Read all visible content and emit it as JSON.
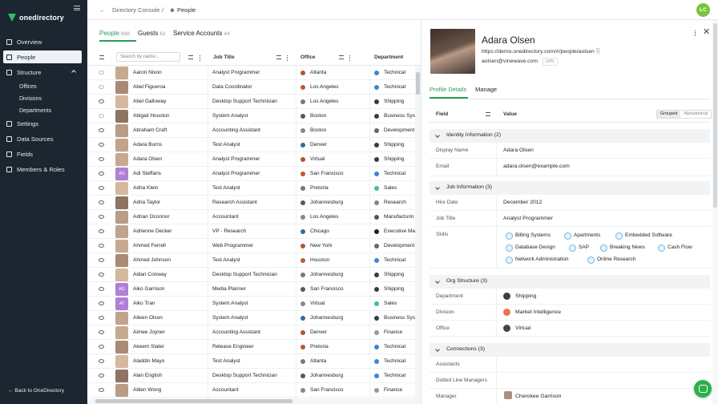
{
  "brand": {
    "name": "onedirectory"
  },
  "user_initials": "LC",
  "breadcrumb": {
    "parent": "Directory Console",
    "current": "People"
  },
  "sidebar": {
    "items": [
      {
        "label": "Overview",
        "icon": "grid-icon"
      },
      {
        "label": "People",
        "icon": "person-icon",
        "active": true
      },
      {
        "label": "Structure",
        "icon": "structure-icon"
      },
      {
        "label": "Settings",
        "icon": "gear-icon"
      },
      {
        "label": "Data Sources",
        "icon": "database-icon"
      },
      {
        "label": "Fields",
        "icon": "fields-icon"
      },
      {
        "label": "Members & Roles",
        "icon": "users-icon"
      }
    ],
    "sub_items": [
      "Offices",
      "Divisions",
      "Departments"
    ],
    "back_label": "Back to OneDirectory"
  },
  "tabs": [
    {
      "label": "People",
      "count": "998",
      "active": true
    },
    {
      "label": "Guests",
      "count": "62"
    },
    {
      "label": "Service Accounts",
      "count": "44"
    }
  ],
  "table": {
    "search_placeholder": "Search by name...",
    "columns": [
      "Job Title",
      "Office",
      "Department"
    ],
    "rows": [
      {
        "name": "Aaron Nixon",
        "job": "Analyst Programmer",
        "office": "Atlanta",
        "dept": "Technical",
        "eye": "dim"
      },
      {
        "name": "Abel Figueroa",
        "job": "Data Coordinator",
        "office": "Los Angeles",
        "dept": "Technical",
        "eye": "dim"
      },
      {
        "name": "Abel Galloway",
        "job": "Desktop Support Technician",
        "office": "Los Angeles",
        "dept": "Shipping"
      },
      {
        "name": "Abigail Houston",
        "job": "System Analyst",
        "office": "Boston",
        "dept": "Business Sys",
        "eye": "dim"
      },
      {
        "name": "Abraham Craft",
        "job": "Accounting Assistant",
        "office": "Boston",
        "dept": "Development"
      },
      {
        "name": "Adara Burns",
        "job": "Test Analyst",
        "office": "Denver",
        "dept": "Shipping"
      },
      {
        "name": "Adara Olsen",
        "job": "Analyst Programmer",
        "office": "Virtual",
        "dept": "Shipping"
      },
      {
        "name": "Adi Steffans",
        "job": "Analyst Programmer",
        "office": "San Francisco",
        "dept": "Technical",
        "initials": "AS"
      },
      {
        "name": "Adria Klein",
        "job": "Test Analyst",
        "office": "Pretoria",
        "dept": "Sales"
      },
      {
        "name": "Adria Taylor",
        "job": "Research Assistant",
        "office": "Johannesburg",
        "dept": "Research"
      },
      {
        "name": "Adrian Oconnor",
        "job": "Accountant",
        "office": "Los Angeles",
        "dept": "Manufacturin"
      },
      {
        "name": "Adrienne Decker",
        "job": "VP - Research",
        "office": "Chicago",
        "dept": "Executive Ma"
      },
      {
        "name": "Ahmed Ferrell",
        "job": "Web Programmer",
        "office": "New York",
        "dept": "Development"
      },
      {
        "name": "Ahmed Johnson",
        "job": "Test Analyst",
        "office": "Houston",
        "dept": "Technical"
      },
      {
        "name": "Aidan Conway",
        "job": "Desktop Support Technician",
        "office": "Johannesburg",
        "dept": "Shipping"
      },
      {
        "name": "Aiko Garrison",
        "job": "Media Planner",
        "office": "San Francisco",
        "dept": "Shipping",
        "initials": "AG"
      },
      {
        "name": "Aiko Tran",
        "job": "System Analyst",
        "office": "Virtual",
        "dept": "Sales",
        "initials": "AT"
      },
      {
        "name": "Aileen Olson",
        "job": "System Analyst",
        "office": "Johannesburg",
        "dept": "Business Sys"
      },
      {
        "name": "Aimee Joyner",
        "job": "Accounting Assistant",
        "office": "Denver",
        "dept": "Finance"
      },
      {
        "name": "Akeem Slater",
        "job": "Release Engineer",
        "office": "Pretoria",
        "dept": "Technical"
      },
      {
        "name": "Aladdin Mayo",
        "job": "Test Analyst",
        "office": "Atlanta",
        "dept": "Technical"
      },
      {
        "name": "Alan English",
        "job": "Desktop Support Technician",
        "office": "Johannesburg",
        "dept": "Technical"
      },
      {
        "name": "Alden Wong",
        "job": "Accountant",
        "office": "San Francisco",
        "dept": "Finance"
      }
    ]
  },
  "profile": {
    "name": "Adara Olsen",
    "url": "https://demo.onedirectory.com/#/people/aolsen",
    "email": "aolsen@vinewave.com",
    "email_badge": "UPN",
    "tabs": [
      "Profile Details",
      "Manage"
    ],
    "field_header": "Field",
    "value_header": "Value",
    "view_toggle": [
      "Grouped",
      "Alphabetical"
    ],
    "sections": {
      "identity": "Identity Information (2)",
      "job": "Job Information (3)",
      "org": "Org Structure (3)",
      "connections": "Connections (3)"
    },
    "fields": {
      "display_name": {
        "label": "Display Name",
        "value": "Adara Olsen"
      },
      "email": {
        "label": "Email",
        "value": "adara.olsen@example.com"
      },
      "hire_date": {
        "label": "Hire Date",
        "value": "December 2012"
      },
      "job_title": {
        "label": "Job Title",
        "value": "Analyst Programmer"
      },
      "skills_label": "Skills",
      "department": {
        "label": "Department",
        "value": "Shipping"
      },
      "division": {
        "label": "Division",
        "value": "Market Intelligence"
      },
      "office": {
        "label": "Office",
        "value": "Virtual"
      },
      "assistants": {
        "label": "Assistants"
      },
      "dotted_line": {
        "label": "Dotted Line Managers"
      },
      "manager": {
        "label": "Manager",
        "value": "Cherokee Garrison"
      }
    },
    "skills": [
      "Billing Systems",
      "Apartments",
      "Embedded Software",
      "Database Design",
      "SAP",
      "Breaking News",
      "Cash Flow",
      "Network Administration",
      "Online Research"
    ]
  },
  "colors": {
    "accent": "#2b9d58",
    "sidebar_bg": "#1b2631",
    "dept_technical": "#3a86d4",
    "dept_shipping": "#3d3d3d",
    "dept_sales": "#3fbf9f",
    "dept_development": "#5b6b7b"
  }
}
